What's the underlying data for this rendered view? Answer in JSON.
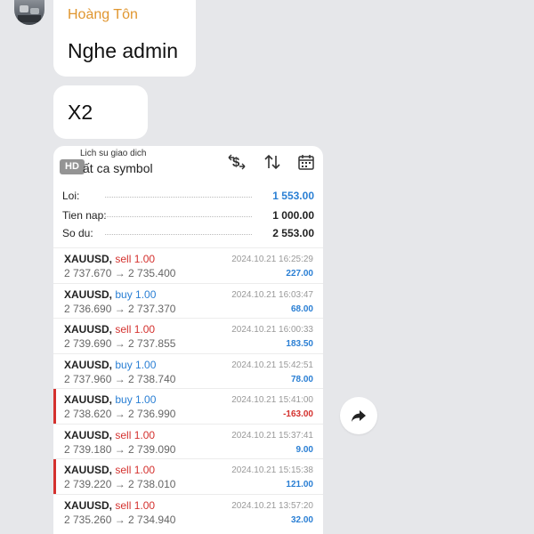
{
  "chat": {
    "sender_name": "Hoàng Tôn",
    "messages": [
      "Nghe admin",
      "X2"
    ]
  },
  "screenshot": {
    "hd_badge": "HD",
    "header_small": "Lich su giao dich",
    "header_title": "ất ca symbol",
    "icons": [
      "dollar-swap-icon",
      "sort-arrows-icon",
      "calendar-icon"
    ],
    "summary": [
      {
        "label": "Loi:",
        "value": "1 553.00",
        "color": "#2a7fd4"
      },
      {
        "label": "Tien nap:",
        "value": "1 000.00",
        "color": "#222222"
      },
      {
        "label": "So du:",
        "value": "2 553.00",
        "color": "#222222"
      }
    ],
    "trades": [
      {
        "symbol": "XAUUSD,",
        "side": "sell 1.00",
        "type": "sell",
        "price": "2 737.670 → 2 735.400",
        "time": "2024.10.21 16:25:29",
        "profit": "227.00",
        "profit_sign": "pos",
        "marked": false
      },
      {
        "symbol": "XAUUSD,",
        "side": "buy 1.00",
        "type": "buy",
        "price": "2 736.690 → 2 737.370",
        "time": "2024.10.21 16:03:47",
        "profit": "68.00",
        "profit_sign": "pos",
        "marked": false
      },
      {
        "symbol": "XAUUSD,",
        "side": "sell 1.00",
        "type": "sell",
        "price": "2 739.690 → 2 737.855",
        "time": "2024.10.21 16:00:33",
        "profit": "183.50",
        "profit_sign": "pos",
        "marked": false
      },
      {
        "symbol": "XAUUSD,",
        "side": "buy 1.00",
        "type": "buy",
        "price": "2 737.960 → 2 738.740",
        "time": "2024.10.21 15:42:51",
        "profit": "78.00",
        "profit_sign": "pos",
        "marked": false
      },
      {
        "symbol": "XAUUSD,",
        "side": "buy 1.00",
        "type": "buy",
        "price": "2 738.620 → 2 736.990",
        "time": "2024.10.21 15:41:00",
        "profit": "-163.00",
        "profit_sign": "neg",
        "marked": true
      },
      {
        "symbol": "XAUUSD,",
        "side": "sell 1.00",
        "type": "sell",
        "price": "2 739.180 → 2 739.090",
        "time": "2024.10.21 15:37:41",
        "profit": "9.00",
        "profit_sign": "pos",
        "marked": false
      },
      {
        "symbol": "XAUUSD,",
        "side": "sell 1.00",
        "type": "sell",
        "price": "2 739.220 → 2 738.010",
        "time": "2024.10.21 15:15:38",
        "profit": "121.00",
        "profit_sign": "pos",
        "marked": true
      },
      {
        "symbol": "XAUUSD,",
        "side": "sell 1.00",
        "type": "sell",
        "price": "2 735.260 → 2 734.940",
        "time": "2024.10.21 13:57:20",
        "profit": "32.00",
        "profit_sign": "pos",
        "marked": false
      }
    ]
  },
  "actions": {
    "share_icon": "forward-arrow-icon"
  },
  "colors": {
    "background": "#e6e7ea",
    "sender": "#e0962f",
    "sell": "#d4312e",
    "buy": "#2a7fd4"
  }
}
